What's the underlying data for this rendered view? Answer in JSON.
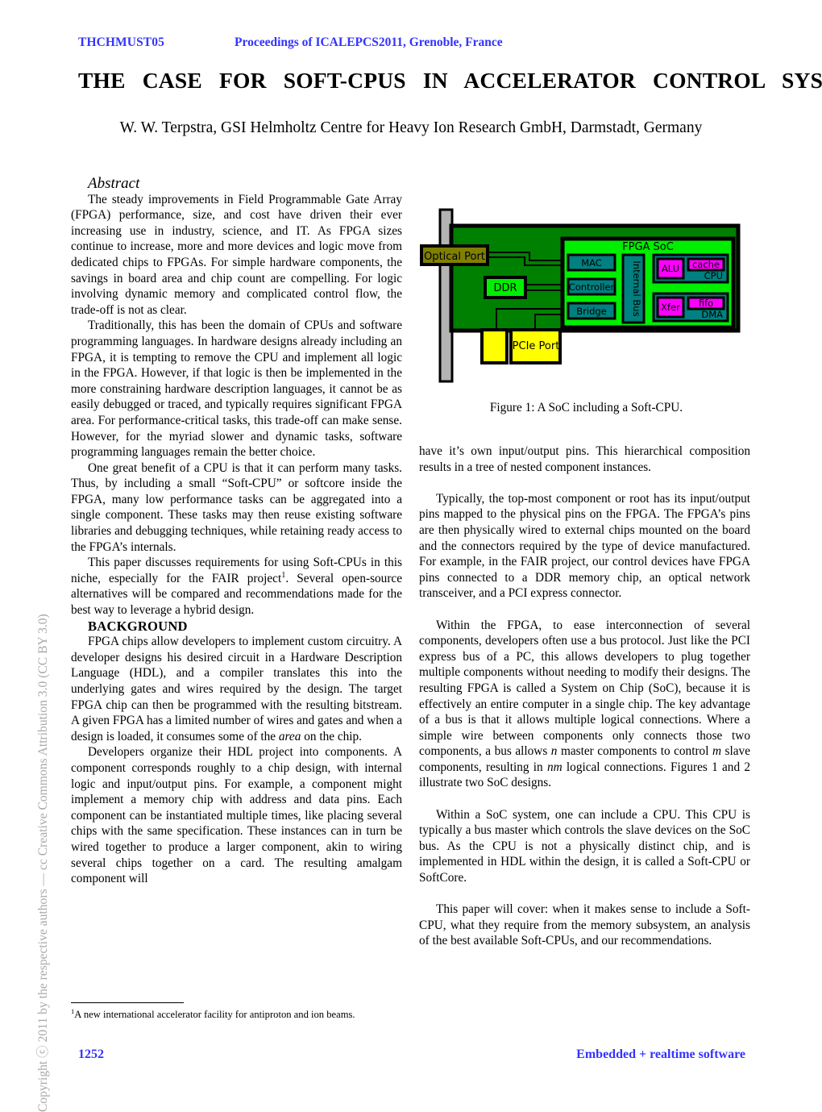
{
  "header": {
    "paper_id": "THCHMUST05",
    "proceedings": "Proceedings of ICALEPCS2011, Grenoble, France"
  },
  "title": "THE CASE FOR SOFT-CPUS IN ACCELERATOR CONTROL SYSTEMS",
  "authors": "W. W. Terpstra, GSI Helmholtz Centre for Heavy Ion Research GmbH, Darmstadt, Germany",
  "abstract": {
    "heading": "Abstract",
    "paragraphs": [
      "The steady improvements in Field Programmable Gate Array (FPGA) performance, size, and cost have driven their ever increasing use in industry, science, and IT. As FPGA sizes continue to increase, more and more devices and logic move from dedicated chips to FPGAs. For simple hardware components, the savings in board area and chip count are compelling. For logic involving dynamic memory and complicated control flow, the trade-off is not as clear.",
      "Traditionally, this has been the domain of CPUs and software programming languages. In hardware designs already including an FPGA, it is tempting to remove the CPU and implement all logic in the FPGA. However, if that logic is then be implemented in the more constraining hardware description languages, it cannot be as easily debugged or traced, and typically requires significant FPGA area. For performance-critical tasks, this trade-off can make sense. However, for the myriad slower and dynamic tasks, software programming languages remain the better choice.",
      "One great benefit of a CPU is that it can perform many tasks. Thus, by including a small “Soft-CPU” or softcore inside the FPGA, many low performance tasks can be aggregated into a single component. These tasks may then reuse existing software libraries and debugging techniques, while retaining ready access to the FPGA’s internals.",
      "This paper discusses requirements for using Soft-CPUs in this niche, especially for the FAIR project"
    ],
    "footnote_marker": "1",
    "paragraph4_tail": ". Several open-source alternatives will be compared and recommendations made for the best way to leverage a hybrid design."
  },
  "background": {
    "heading": "BACKGROUND",
    "paragraphs": [
      "FPGA chips allow developers to implement custom circuitry. A developer designs his desired circuit in a Hardware Description Language (HDL), and a compiler translates this into the underlying gates and wires required by the design. The target FPGA chip can then be programmed with the resulting bitstream. A given FPGA has a limited number of wires and gates and when a design is loaded, it consumes some of the ",
      " on the chip.",
      "Developers organize their HDL project into components. A component corresponds roughly to a chip design, with internal logic and input/output pins. For example, a component might implement a memory chip with address and data pins. Each component can be instantiated multiple times, like placing several chips with the same specification. These instances can in turn be wired together to produce a larger component, akin to wiring several chips together on a card. The resulting amalgam component will"
    ],
    "italic_word": "area"
  },
  "right_column": {
    "paragraphs": [
      "have it’s own input/output pins. This hierarchical composition results in a tree of nested component instances.",
      "Typically, the top-most component or root has its input/output pins mapped to the physical pins on the FPGA. The FPGA’s pins are then physically wired to external chips mounted on the board and the connectors required by the type of device manufactured. For example, in the FAIR project, our control devices have FPGA pins connected to a DDR memory chip, an optical network transceiver, and a PCI express connector.",
      "Within the FPGA, to ease interconnection of several components, developers often use a bus protocol. Just like the PCI express bus of a PC, this allows developers to plug together multiple components without needing to modify their designs. The resulting FPGA is called a System on Chip (SoC), because it is effectively an entire computer in a single chip. The key advantage of a bus is that it allows multiple logical connections. Where a simple wire between components only connects those two components, a bus allows ",
      " master components to control ",
      " slave components, resulting in ",
      " logical connections. Figures 1 and 2 illustrate two SoC designs.",
      "Within a SoC system, one can include a CPU. This CPU is typically a bus master which controls the slave devices on the SoC bus. As the CPU is not a physically distinct chip, and is implemented in HDL within the design, it is called a Soft-CPU or SoftCore.",
      "This paper will cover: when it makes sense to include a Soft-CPU, what they require from the memory subsystem, an analysis of the best available Soft-CPUs, and our recommendations."
    ],
    "math_n": "n",
    "math_m": "m",
    "math_nm": "nm"
  },
  "figure": {
    "caption": "Figure 1: A SoC including a Soft-CPU.",
    "diagram_type": "block-diagram",
    "colors": {
      "board": "#008000",
      "soc": "#00ee00",
      "bracket": "#b3b3b3",
      "optical_port": "#808000",
      "ddr": "#00ee00",
      "pcie": "#ffff00",
      "peripheral": "#008080",
      "accent": "#ff00ff",
      "outline": "#000000"
    },
    "blocks": {
      "soc_title": "FPGA SoC",
      "optical_port": "Optical Port",
      "ddr": "DDR",
      "pcie_port": "PCIe Port",
      "mac": "MAC",
      "controller": "Controller",
      "bridge": "Bridge",
      "internal_bus": "Internal Bus",
      "alu": "ALU",
      "cache": "cache",
      "cpu": "CPU",
      "xfer": "Xfer",
      "fifo": "fifo",
      "dma": "DMA"
    }
  },
  "footnote": {
    "marker": "1",
    "text": "A new international accelerator facility for antiproton and ion beams."
  },
  "copyright_sidebar": "Copyright ⓒ 2011 by the respective authors — cc Creative Commons Attribution 3.0 (CC BY 3.0)",
  "footer": {
    "page_number": "1252",
    "track": "Embedded + realtime software"
  }
}
